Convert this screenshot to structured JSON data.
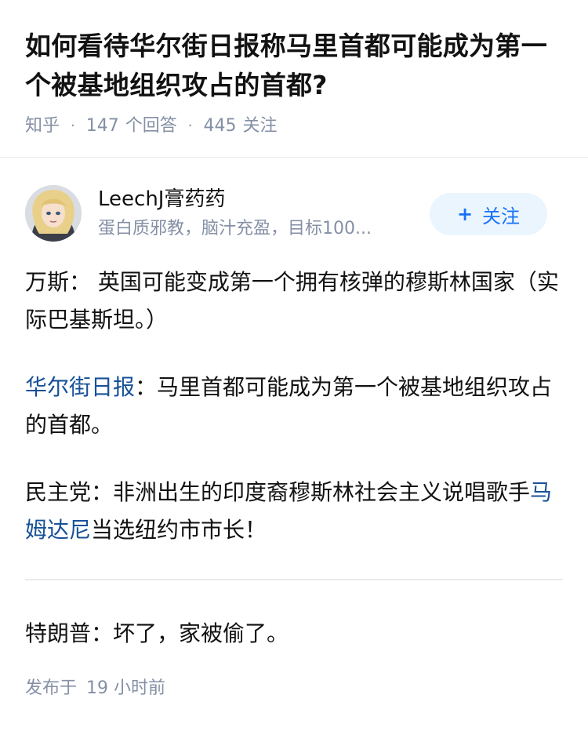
{
  "question": {
    "title": "如何看待华尔街日报称马里首都可能成为第一个被基地组织攻占的首都?",
    "source": "知乎",
    "answer_count": "147",
    "answer_label": "个回答",
    "follower_count": "445",
    "follower_label": "关注"
  },
  "author": {
    "name": "LeechJ膏药药",
    "headline": "蛋白质邪教，脑汁充盈，目标100...",
    "follow_label": "关注",
    "follow_icon": "+"
  },
  "answer": {
    "p1": "万斯： 英国可能变成第一个拥有核弹的穆斯林国家（实际巴基斯坦。）",
    "p2_link": "华尔街日报",
    "p2_text": "：马里首都可能成为第一个被基地组织攻占的首都。",
    "p3_pre": "民主党：非洲出生的印度裔穆斯林社会主义说唱歌手",
    "p3_link": "马姆达尼",
    "p3_post": "当选纽约市市长！",
    "p4": "特朗普：坏了，家被偷了。"
  },
  "footer": {
    "publish_label": "发布于",
    "publish_time": "19 小时前"
  },
  "colors": {
    "link": "#175199",
    "accent": "#1772f6",
    "follow_bg": "#ebf5fe",
    "meta": "#8590a6"
  }
}
